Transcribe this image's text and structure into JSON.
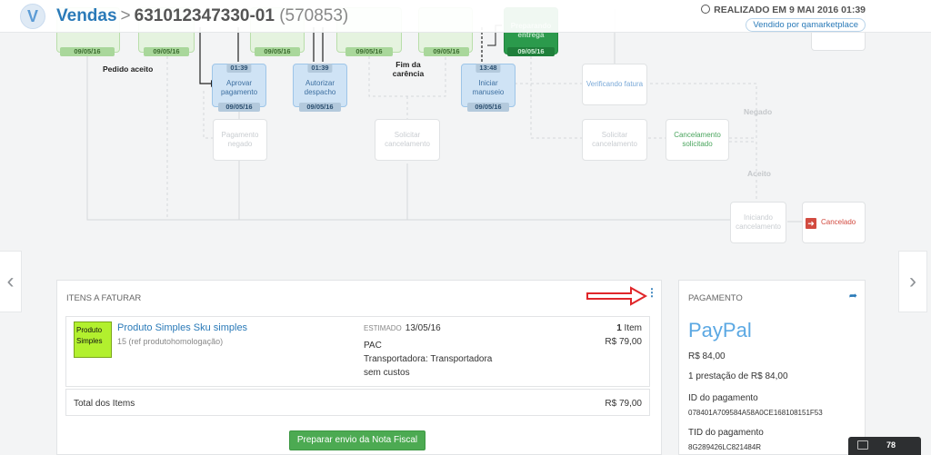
{
  "header": {
    "breadcrumb_root": "Vendas",
    "breadcrumb_sep": ">",
    "order_id": "631012347330-01",
    "order_seq": "(570853)",
    "realizado": "REALIZADO EM 9 MAI 2016 01:39",
    "vendido": "Vendido por qamarketplace"
  },
  "flow": {
    "top_dates": [
      "09/05/16",
      "09/05/16",
      "09/05/16",
      "09/05/16",
      "09/05/16",
      "09/05/16"
    ],
    "preparando": "Preparando entrega",
    "pedido_aceito": "Pedido aceito",
    "fim_carencia": "Fim da carência",
    "aprovar": {
      "time": "01:39",
      "label": "Aprovar pagamento",
      "date": "09/05/16"
    },
    "autorizar": {
      "time": "01:39",
      "label": "Autorizar despacho",
      "date": "09/05/16"
    },
    "iniciar": {
      "time": "13:48",
      "label": "Iniciar manuseio",
      "date": "09/05/16"
    },
    "verificando": "Verificando fatura",
    "pagamento_negado": "Pagamento negado",
    "solicitar_cancel_1": "Solicitar cancelamento",
    "solicitar_cancel_2": "Solicitar cancelamento",
    "cancel_solicitado": "Cancelamento solicitado",
    "negado": "Negado",
    "aceito": "Aceito",
    "iniciando_cancel": "Iniciando cancelamento",
    "cancelado": "Cancelado"
  },
  "items": {
    "title": "ITENS A FATURAR",
    "thumb_text": "Produto Simples",
    "product": "Produto Simples Sku simples",
    "ref": "15 (ref produtohomologação)",
    "estimado_label": "ESTIMADO",
    "estimado_date": "13/05/16",
    "ship_method": "PAC",
    "transportadora": "Transportadora: Transportadora",
    "sem_custos": "sem custos",
    "qty_num": "1",
    "qty_label": "Item",
    "price": "R$ 79,00",
    "total_label": "Total dos Items",
    "total_value": "R$ 79,00",
    "button": "Preparar envio da Nota Fiscal"
  },
  "payment": {
    "title": "PAGAMENTO",
    "method": "PayPal",
    "amount": "R$ 84,00",
    "installments": "1 prestação de R$ 84,00",
    "id_label": "ID do pagamento",
    "id_value": "078401A709584A58A0CE168108151F53",
    "tid_label": "TID do pagamento",
    "tid_value": "8G289426LC821484R"
  },
  "footer_badge": {
    "count": "78"
  },
  "colors": {
    "accent": "#2a7ab8",
    "green": "#4caa52",
    "red": "#d24b40",
    "paypal": "#5ba8e3"
  }
}
